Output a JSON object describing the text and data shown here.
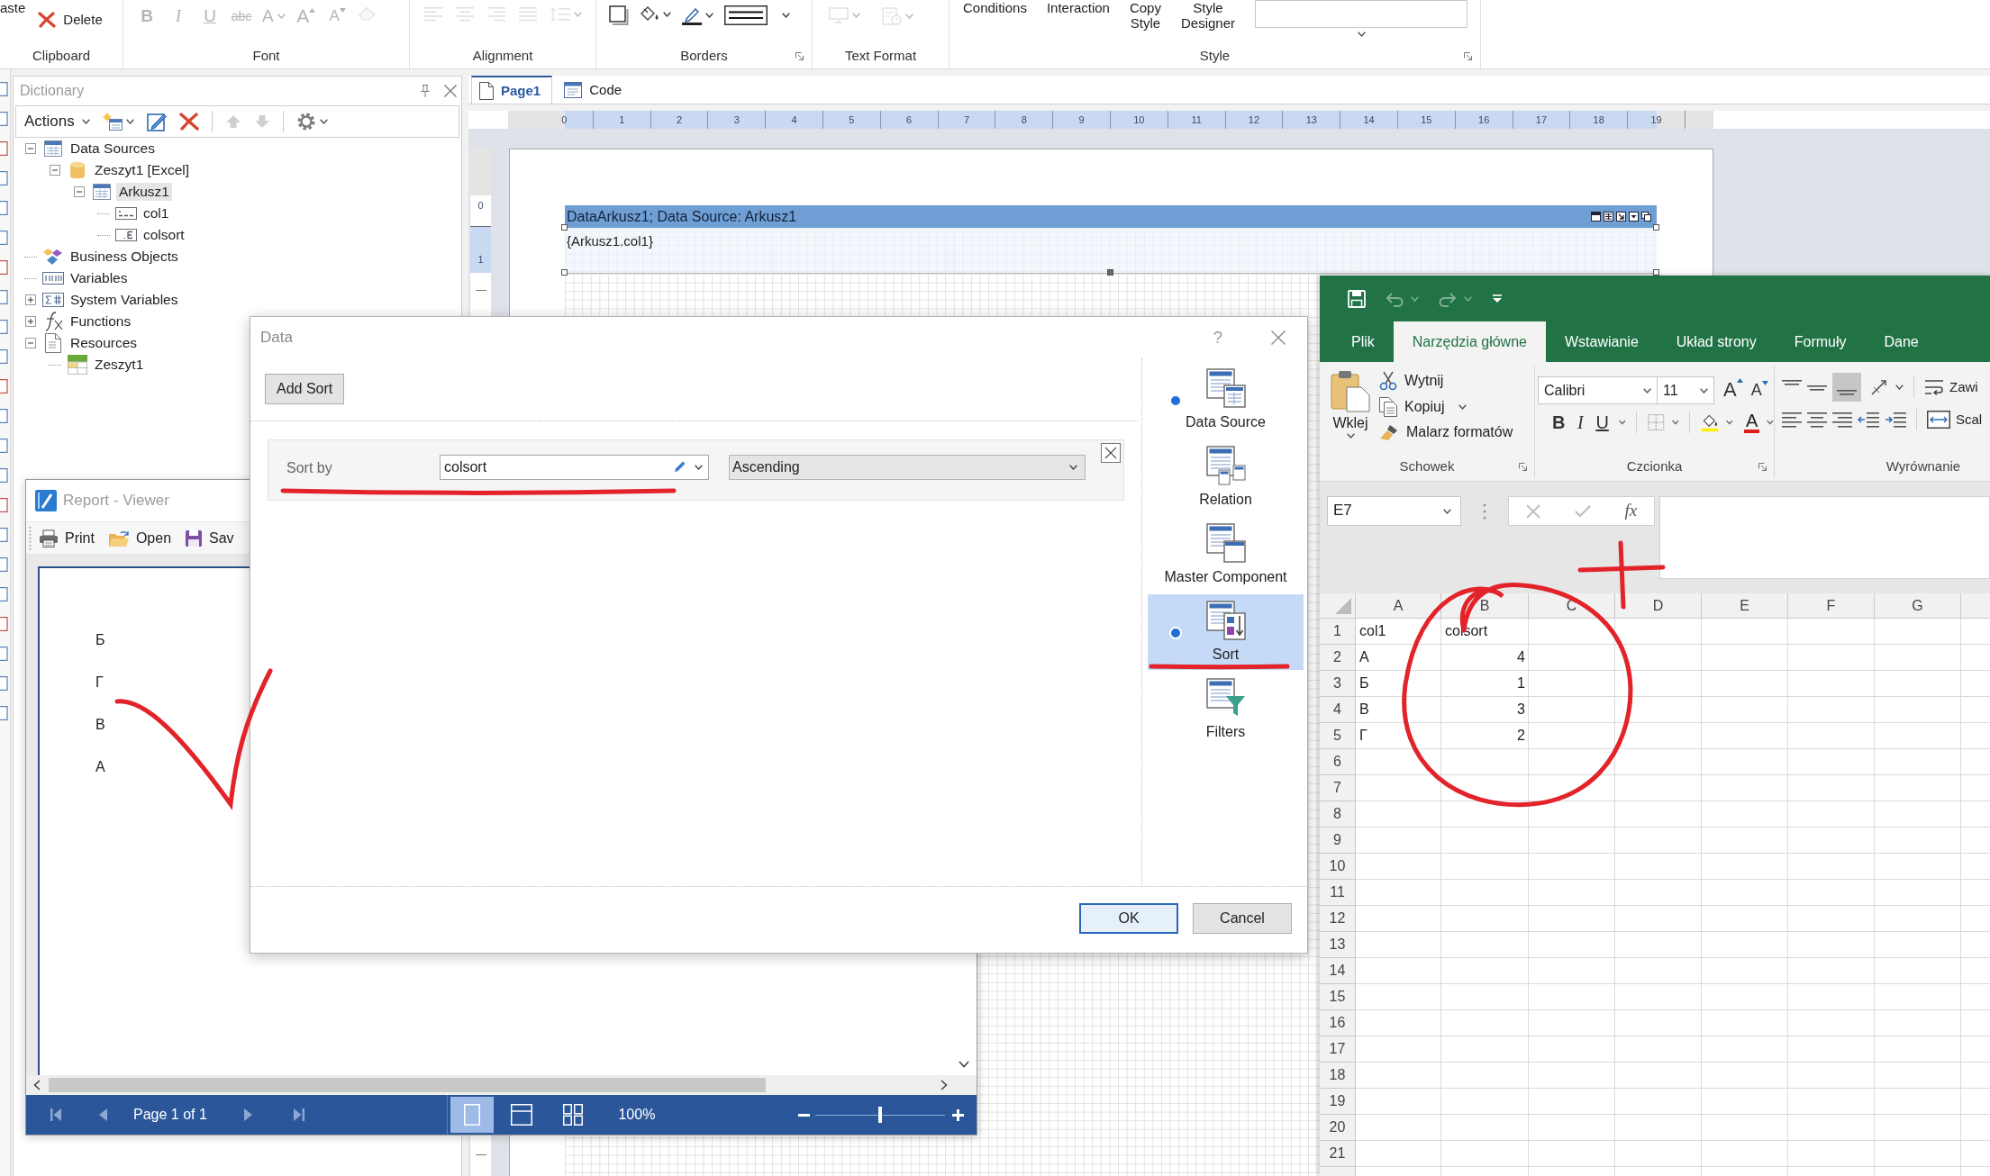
{
  "ribbon": {
    "groups": [
      {
        "kind": "clipboard",
        "label": "Clipboard",
        "items": [
          {
            "kind": "paste",
            "label": "aste"
          },
          {
            "kind": "delete",
            "label": "Delete"
          }
        ]
      },
      {
        "kind": "font",
        "label": "Font",
        "items": [
          {
            "kind": "bold",
            "glyph": "B",
            "disabled": true
          },
          {
            "kind": "italic",
            "glyph": "I",
            "disabled": true
          },
          {
            "kind": "underline",
            "glyph": "U",
            "disabled": true
          },
          {
            "kind": "strikethrough",
            "glyph": "abc",
            "disabled": true
          },
          {
            "kind": "font-color",
            "glyph": "A",
            "disabled": true
          },
          {
            "kind": "grow-font",
            "glyph": "A",
            "disabled": true
          },
          {
            "kind": "shrink-font",
            "glyph": "A",
            "disabled": true
          },
          {
            "kind": "clear",
            "disabled": true
          }
        ]
      },
      {
        "kind": "alignment",
        "label": "Alignment",
        "items": [
          {
            "kind": "align-left",
            "disabled": true
          },
          {
            "kind": "align-center",
            "disabled": true
          },
          {
            "kind": "align-right",
            "disabled": true
          },
          {
            "kind": "justify",
            "disabled": true
          },
          {
            "kind": "line-spacing",
            "disabled": true
          }
        ]
      },
      {
        "kind": "borders",
        "label": "Borders",
        "items": [
          {
            "kind": "border",
            "disabled": false
          },
          {
            "kind": "fill",
            "disabled": false
          },
          {
            "kind": "pen",
            "disabled": false
          },
          {
            "kind": "line-style",
            "disabled": false
          }
        ]
      },
      {
        "kind": "text-format",
        "label": "Text Format",
        "items": [
          {
            "kind": "monitor",
            "disabled": true
          },
          {
            "kind": "calendar",
            "disabled": true
          }
        ]
      },
      {
        "kind": "style",
        "label": "Style",
        "items": [
          {
            "kind": "button",
            "label": "Conditions"
          },
          {
            "kind": "button",
            "label": "Interaction"
          },
          {
            "kind": "button",
            "label": "Copy Style"
          },
          {
            "kind": "button",
            "label": "Style Designer"
          },
          {
            "kind": "gallery"
          }
        ]
      }
    ]
  },
  "dictionary": {
    "title": "Dictionary",
    "actions": "Actions",
    "tools": [
      {
        "kind": "new",
        "disabled": false
      },
      {
        "kind": "edit",
        "disabled": false
      },
      {
        "kind": "delete",
        "disabled": false
      },
      {
        "kind": "up",
        "disabled": true
      },
      {
        "kind": "down",
        "disabled": true
      },
      {
        "kind": "settings",
        "disabled": false
      }
    ],
    "tree": [
      {
        "label": "Data Sources",
        "kind": "datasources",
        "expanded": true,
        "selected": false,
        "children": [
          {
            "label": "Zeszyt1 [Excel]",
            "kind": "database",
            "expanded": true,
            "selected": false,
            "children": [
              {
                "label": "Arkusz1",
                "kind": "table",
                "expanded": true,
                "selected": true,
                "children": [
                  {
                    "label": "col1",
                    "kind": "text",
                    "selected": false
                  },
                  {
                    "label": "colsort",
                    "kind": "number",
                    "selected": false
                  }
                ]
              }
            ]
          }
        ]
      },
      {
        "label": "Business Objects",
        "kind": "business",
        "selected": false
      },
      {
        "label": "Variables",
        "kind": "variables",
        "selected": false
      },
      {
        "label": "System Variables",
        "kind": "system",
        "expanded": false,
        "selected": false
      },
      {
        "label": "Functions",
        "kind": "functions",
        "expanded": false,
        "selected": false
      },
      {
        "label": "Resources",
        "kind": "resources",
        "expanded": true,
        "selected": false,
        "children": [
          {
            "label": "Zeszyt1",
            "kind": "xls",
            "selected": false
          }
        ]
      }
    ]
  },
  "designer": {
    "tabs": [
      {
        "label": "Page1",
        "kind": "page",
        "selected": true
      },
      {
        "label": "Code",
        "kind": "code",
        "selected": false
      }
    ],
    "ruler": [
      "0",
      "1",
      "2",
      "3",
      "4",
      "5",
      "6",
      "7",
      "8",
      "9",
      "10",
      "11",
      "12",
      "13",
      "14",
      "15",
      "16",
      "17",
      "18",
      "19"
    ],
    "vertical_ruler": [
      "0",
      "1"
    ],
    "band": {
      "title": "DataArkusz1; Data Source: Arkusz1",
      "expression": "{Arkusz1.col1}"
    }
  },
  "report_viewer": {
    "title": "Report - Viewer",
    "toolbar": [
      {
        "kind": "print",
        "label": "Print"
      },
      {
        "kind": "open",
        "label": "Open"
      },
      {
        "kind": "save",
        "label": "Sav"
      }
    ],
    "page_lines": [
      "Б",
      "Г",
      "В",
      "А"
    ],
    "navigation": [
      {
        "kind": "first",
        "disabled": true
      },
      {
        "kind": "previous",
        "disabled": true
      },
      {
        "kind": "page",
        "label": "Page 1 of 1"
      },
      {
        "kind": "next",
        "disabled": true
      },
      {
        "kind": "last",
        "disabled": true
      }
    ],
    "view_modes": [
      {
        "kind": "single",
        "selected": true
      },
      {
        "kind": "continuous",
        "selected": false
      },
      {
        "kind": "multiple",
        "selected": false
      }
    ],
    "zoom": "100%",
    "zoom_slider": {
      "level": 0.5
    }
  },
  "data_dialog": {
    "title": "Data",
    "help": "?",
    "add_sort": "Add Sort",
    "sorts": [
      {
        "label": "Sort by",
        "column": "colsort",
        "direction": "Ascending"
      }
    ],
    "sections": [
      {
        "label": "Data Source",
        "kind": "datasource",
        "selected": false,
        "configured": true
      },
      {
        "label": "Relation",
        "kind": "relation",
        "selected": false,
        "configured": false
      },
      {
        "label": "Master Component",
        "kind": "master",
        "selected": false,
        "configured": false
      },
      {
        "label": "Sort",
        "kind": "sort",
        "selected": true,
        "configured": true
      },
      {
        "label": "Filters",
        "kind": "filters",
        "selected": false,
        "configured": false
      }
    ],
    "buttons": [
      {
        "label": "OK",
        "default": true
      },
      {
        "label": "Cancel",
        "default": false
      }
    ]
  },
  "excel": {
    "quick_access": [
      {
        "kind": "save",
        "disabled": false
      },
      {
        "kind": "undo",
        "disabled": true
      },
      {
        "kind": "redo",
        "disabled": true
      },
      {
        "kind": "customize",
        "disabled": false
      }
    ],
    "tabs": [
      {
        "label": "Plik",
        "selected": false
      },
      {
        "label": "Narzędzia główne",
        "selected": true
      },
      {
        "label": "Wstawianie",
        "selected": false
      },
      {
        "label": "Układ strony",
        "selected": false
      },
      {
        "label": "Formuły",
        "selected": false
      },
      {
        "label": "Dane",
        "selected": false
      }
    ],
    "clipboard": {
      "label": "Schowek",
      "paste": "Wklej",
      "cut": "Wytnij",
      "copy": "Kopiuj",
      "format_painter": "Malarz formatów"
    },
    "font": {
      "label": "Czcionka",
      "name": "Calibri",
      "size": "11",
      "grow": "A",
      "shrink": "A",
      "styles": [
        {
          "kind": "bold",
          "glyph": "B"
        },
        {
          "kind": "italic",
          "glyph": "I"
        },
        {
          "kind": "underline",
          "glyph": "U"
        }
      ],
      "font_color": "A"
    },
    "alignment": {
      "label": "Wyrównanie",
      "vertical": [
        {
          "kind": "top",
          "selected": false
        },
        {
          "kind": "middle",
          "selected": false
        },
        {
          "kind": "bottom",
          "selected": true
        }
      ],
      "wrap": "Zawi",
      "merge": "Scal"
    },
    "name_box": "E7",
    "formula_buttons": [
      {
        "kind": "cancel",
        "disabled": true
      },
      {
        "kind": "enter",
        "disabled": true
      },
      {
        "kind": "function",
        "glyph": "fx",
        "disabled": false
      }
    ],
    "columns": [
      "A",
      "B",
      "C",
      "D",
      "E",
      "F",
      "G"
    ],
    "rows": [
      {
        "header": "1",
        "cells": [
          {
            "text": "col1",
            "kind": "text"
          },
          {
            "text": "colsort",
            "kind": "text"
          }
        ]
      },
      {
        "header": "2",
        "cells": [
          {
            "text": "А",
            "kind": "text"
          },
          {
            "text": "4",
            "kind": "number"
          }
        ]
      },
      {
        "header": "3",
        "cells": [
          {
            "text": "Б",
            "kind": "text"
          },
          {
            "text": "1",
            "kind": "number"
          }
        ]
      },
      {
        "header": "4",
        "cells": [
          {
            "text": "В",
            "kind": "text"
          },
          {
            "text": "3",
            "kind": "number"
          }
        ]
      },
      {
        "header": "5",
        "cells": [
          {
            "text": "Г",
            "kind": "text"
          },
          {
            "text": "2",
            "kind": "number"
          }
        ]
      },
      {
        "header": "6"
      },
      {
        "header": "7"
      },
      {
        "header": "8"
      },
      {
        "header": "9"
      },
      {
        "header": "10"
      },
      {
        "header": "11"
      },
      {
        "header": "12"
      },
      {
        "header": "13"
      },
      {
        "header": "14"
      },
      {
        "header": "15"
      },
      {
        "header": "16"
      },
      {
        "header": "17"
      },
      {
        "header": "18"
      },
      {
        "header": "19"
      },
      {
        "header": "20"
      },
      {
        "header": "21"
      }
    ]
  }
}
